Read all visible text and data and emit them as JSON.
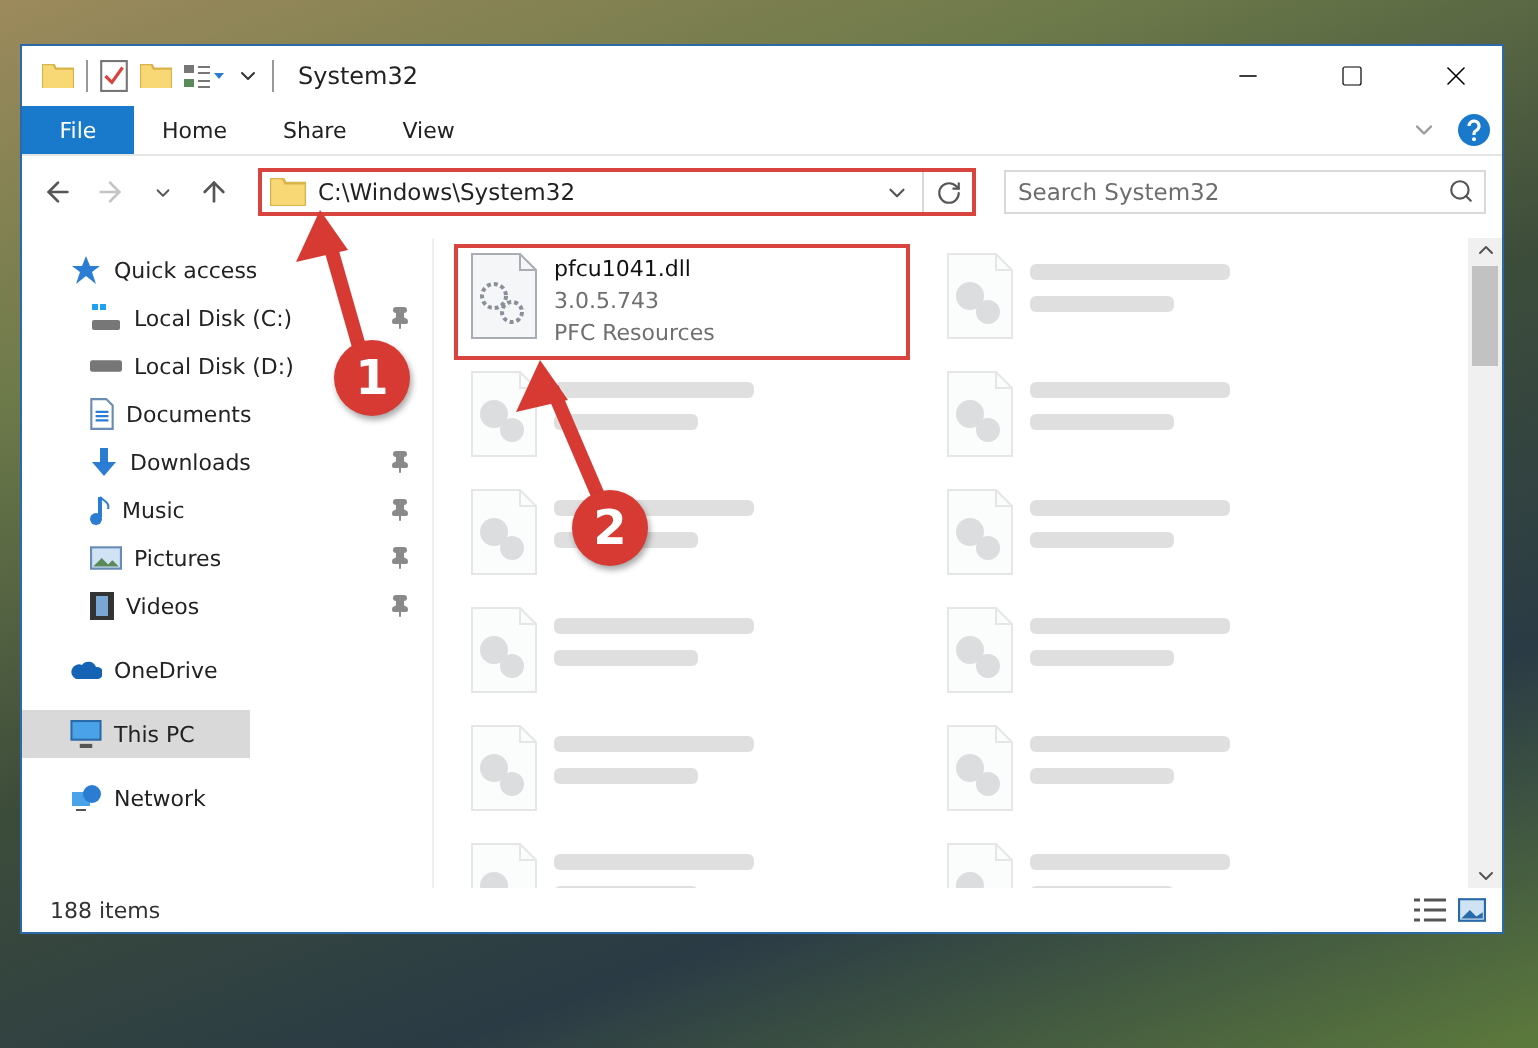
{
  "window": {
    "title": "System32"
  },
  "ribbon": {
    "tabs": [
      {
        "label": "File",
        "kind": "file"
      },
      {
        "label": "Home",
        "kind": "tab"
      },
      {
        "label": "Share",
        "kind": "tab"
      },
      {
        "label": "View",
        "kind": "tab"
      }
    ]
  },
  "address_bar": {
    "path": "C:\\Windows\\System32",
    "highlighted": true
  },
  "search": {
    "placeholder": "Search System32"
  },
  "sidebar": {
    "items": [
      {
        "label": "Quick access",
        "kind": "star",
        "selected": false,
        "children": [
          {
            "label": "Local Disk (C:)",
            "kind": "drive-c",
            "pinned": true,
            "selected": false
          },
          {
            "label": "Local Disk (D:)",
            "kind": "drive",
            "pinned": false,
            "selected": false
          },
          {
            "label": "Documents",
            "kind": "document",
            "pinned": false,
            "selected": false
          },
          {
            "label": "Downloads",
            "kind": "download",
            "pinned": true,
            "selected": false
          },
          {
            "label": "Music",
            "kind": "music",
            "pinned": true,
            "selected": false
          },
          {
            "label": "Pictures",
            "kind": "picture",
            "pinned": true,
            "selected": false
          },
          {
            "label": "Videos",
            "kind": "video",
            "pinned": true,
            "selected": false
          }
        ]
      },
      {
        "label": "OneDrive",
        "kind": "cloud",
        "selected": false
      },
      {
        "label": "This PC",
        "kind": "monitor",
        "selected": true
      },
      {
        "label": "Network",
        "kind": "network",
        "selected": false
      }
    ]
  },
  "files": [
    {
      "kind": "file",
      "name": "pfcu1041.dll",
      "lines": [
        "3.0.5.743",
        "PFC Resources"
      ],
      "highlighted": true
    },
    {
      "kind": "blurred"
    },
    {
      "kind": "blurred"
    },
    {
      "kind": "blurred"
    },
    {
      "kind": "blurred"
    },
    {
      "kind": "blurred"
    },
    {
      "kind": "blurred"
    },
    {
      "kind": "blurred"
    },
    {
      "kind": "blurred"
    },
    {
      "kind": "blurred"
    },
    {
      "kind": "blurred"
    },
    {
      "kind": "blurred"
    }
  ],
  "status_bar": {
    "count": "188 items"
  },
  "callouts": [
    {
      "number": "1"
    },
    {
      "number": "2"
    }
  ]
}
